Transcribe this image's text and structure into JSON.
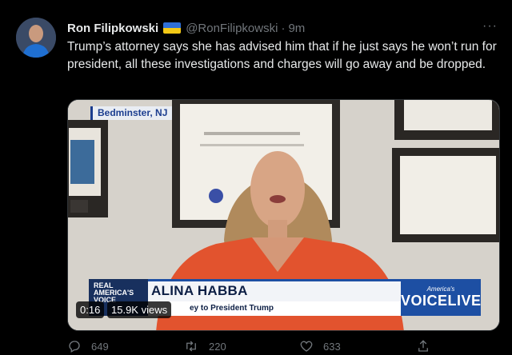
{
  "tweet": {
    "author_name": "Ron Filipkowski",
    "handle": "@RonFilipkowski",
    "separator": "·",
    "time": "9m",
    "more_label": "···",
    "text": "Trump’s attorney says she has advised him that if he just says he won’t run for president, all these investigations and charges will go away and be dropped."
  },
  "video": {
    "location_tag": "Bedminster, NJ",
    "lower_third": {
      "network_small_logo": "REAL AMERICA'S VOICE",
      "name": "ALINA HABBA",
      "subtitle": "ey to President Trump",
      "network_logo_small": "America's",
      "network_logo_big": "VOICELIVE"
    },
    "timestamp": "0:16",
    "views": "15.9K views"
  },
  "actions": {
    "replies": "649",
    "retweets": "220",
    "likes": "633"
  },
  "colors": {
    "background": "#000000",
    "text_primary": "#e7e9ea",
    "text_secondary": "#71767b",
    "flag_blue": "#2f6fd6",
    "flag_yellow": "#f3c916"
  },
  "icons": {
    "reply": "speech-bubble-icon",
    "retweet": "retweet-arrows-icon",
    "like": "heart-icon",
    "share": "share-upload-icon",
    "more": "ellipsis-icon"
  }
}
